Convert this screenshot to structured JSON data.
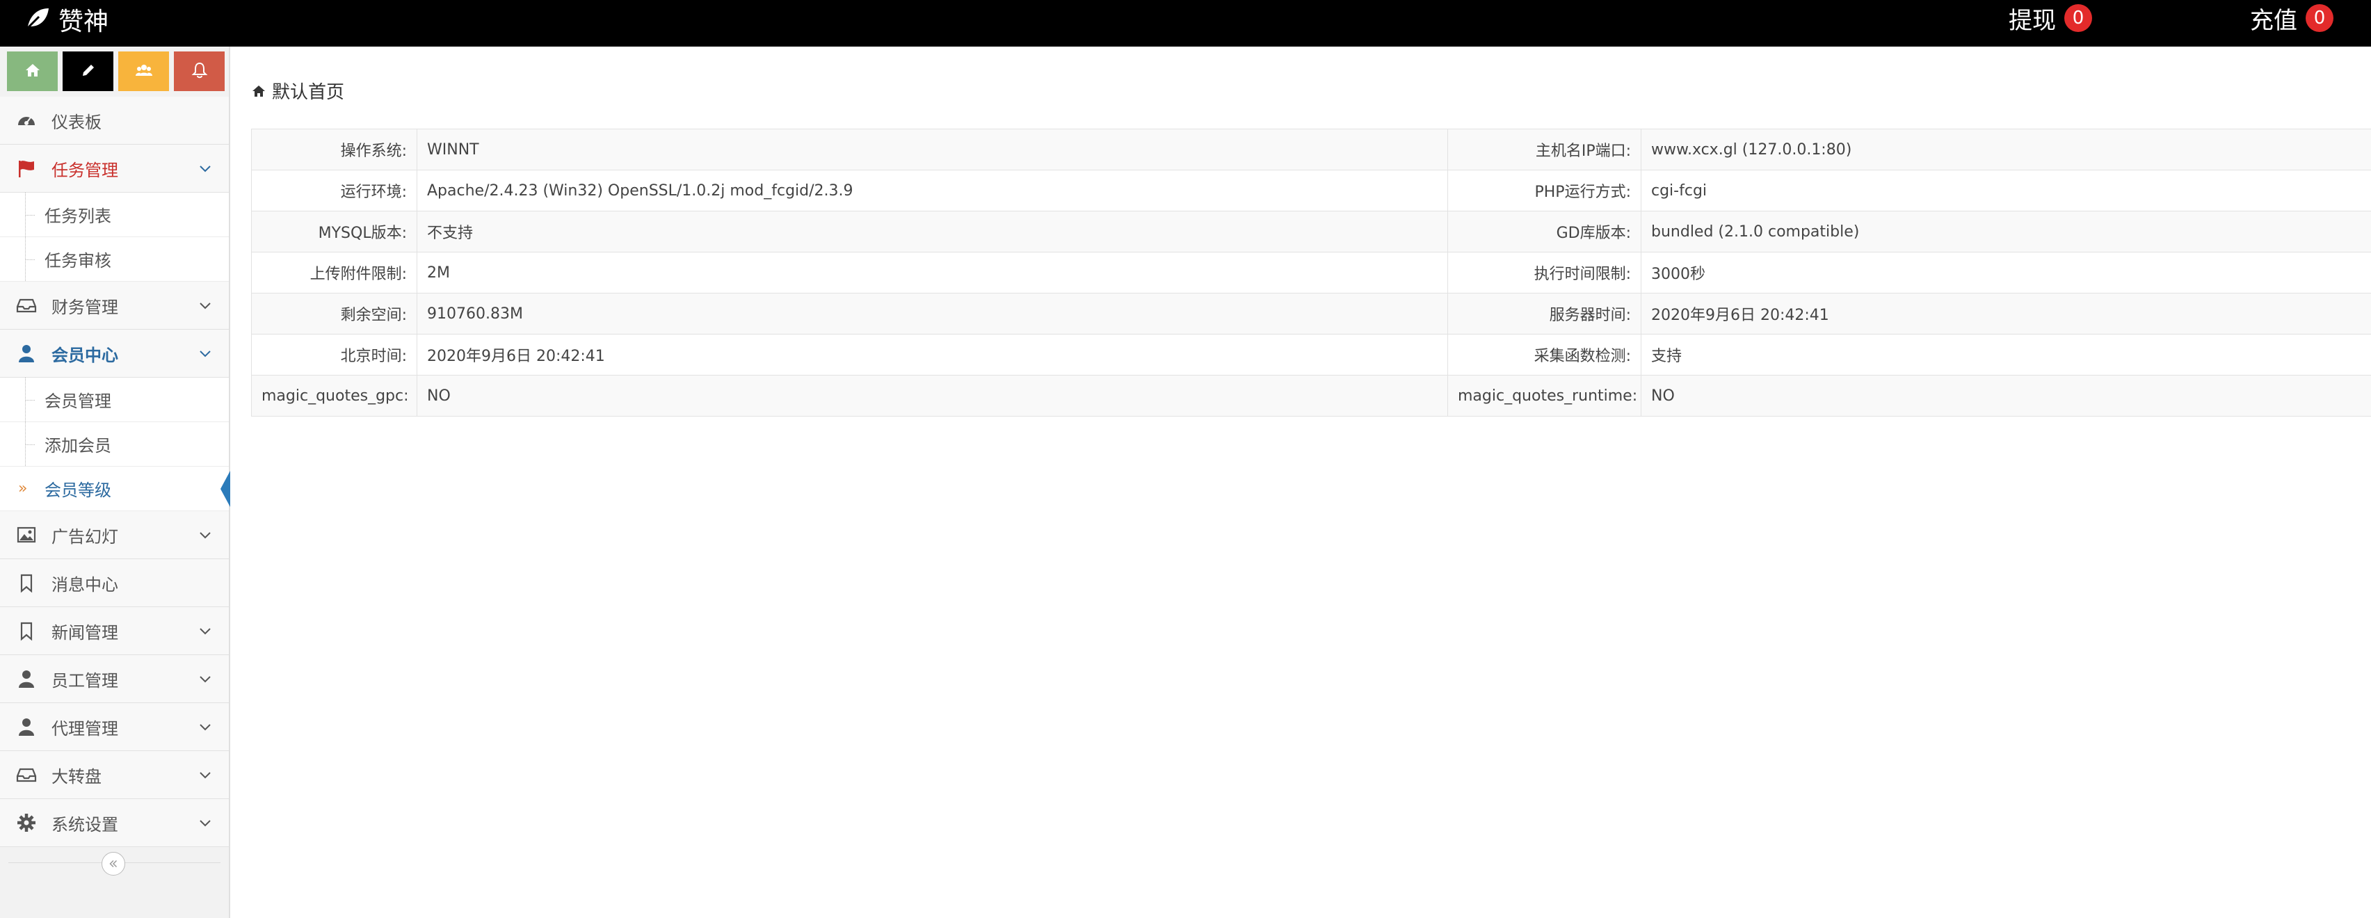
{
  "header": {
    "brand": "赞神",
    "withdraw": {
      "label": "提现",
      "count": "0"
    },
    "recharge": {
      "label": "充值",
      "count": "0"
    }
  },
  "shortcuts": [
    {
      "icon": "home-icon",
      "color": "#87b87f"
    },
    {
      "icon": "pencil-icon",
      "color": "#000000"
    },
    {
      "icon": "users-icon",
      "color": "#f8b43c"
    },
    {
      "icon": "bell-icon",
      "color": "#d15b47"
    }
  ],
  "sidebar": {
    "items": [
      {
        "label": "仪表板",
        "icon": "dashboard-icon"
      },
      {
        "label": "任务管理",
        "icon": "flag-icon",
        "expanded": true,
        "children": [
          "任务列表",
          "任务审核"
        ]
      },
      {
        "label": "财务管理",
        "icon": "inbox-icon"
      },
      {
        "label": "会员中心",
        "icon": "user-icon",
        "expanded": true,
        "children": [
          "会员管理",
          "添加会员",
          "会员等级"
        ],
        "active_child": "会员等级"
      },
      {
        "label": "广告幻灯",
        "icon": "picture-icon"
      },
      {
        "label": "消息中心",
        "icon": "bookmark-icon"
      },
      {
        "label": "新闻管理",
        "icon": "bookmark-icon"
      },
      {
        "label": "员工管理",
        "icon": "user-icon"
      },
      {
        "label": "代理管理",
        "icon": "user-icon"
      },
      {
        "label": "大转盘",
        "icon": "inbox-icon"
      },
      {
        "label": "系统设置",
        "icon": "gear-icon"
      }
    ]
  },
  "breadcrumb": {
    "label": "默认首页"
  },
  "info_table": [
    [
      "操作系统:",
      "WINNT",
      "主机名IP端口:",
      "www.xcx.gl (127.0.0.1:80)"
    ],
    [
      "运行环境:",
      "Apache/2.4.23 (Win32) OpenSSL/1.0.2j mod_fcgid/2.3.9",
      "PHP运行方式:",
      "cgi-fcgi"
    ],
    [
      "MYSQL版本:",
      "不支持",
      "GD库版本:",
      "bundled (2.1.0 compatible)"
    ],
    [
      "上传附件限制:",
      "2M",
      "执行时间限制:",
      "3000秒"
    ],
    [
      "剩余空间:",
      "910760.83M",
      "服务器时间:",
      "2020年9月6日 20:42:41"
    ],
    [
      "北京时间:",
      "2020年9月6日 20:42:41",
      "采集函数检测:",
      "支持"
    ],
    [
      "magic_quotes_gpc:",
      "NO",
      "magic_quotes_runtime:",
      "NO"
    ]
  ],
  "colors": {
    "topbar": "#000000",
    "badge": "#e32b2b",
    "active_red": "#c9302c",
    "active_blue": "#2c6aa0"
  }
}
